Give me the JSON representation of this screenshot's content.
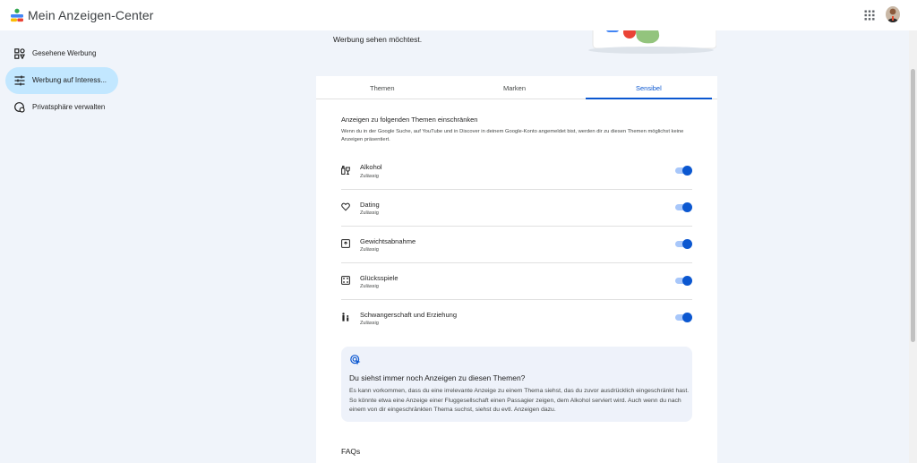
{
  "app": {
    "title": "Mein Anzeigen-Center"
  },
  "topbar": {
    "apps_icon": "apps-grid-icon",
    "avatar": "account-avatar"
  },
  "sidebar": {
    "items": [
      {
        "label": "Gesehene Werbung",
        "icon": "seen-ads-icon",
        "active": false
      },
      {
        "label": "Werbung auf Interess...",
        "icon": "tune-icon",
        "active": true
      },
      {
        "label": "Privatsphäre verwalten",
        "icon": "privacy-icon",
        "active": false
      }
    ]
  },
  "intro": {
    "text": "Werbung sehen möchtest."
  },
  "tabs": [
    {
      "label": "Themen",
      "active": false
    },
    {
      "label": "Marken",
      "active": false
    },
    {
      "label": "Sensibel",
      "active": true
    }
  ],
  "section": {
    "title": "Anzeigen zu folgenden Themen einschränken",
    "description": "Wenn du in der Google Suche, auf YouTube und in Discover in deinem Google-Konto angemeldet bist, werden dir zu diesen Themen möglichst keine Anzeigen präsentiert."
  },
  "topics": [
    {
      "title": "Alkohol",
      "status": "Zulässig",
      "icon": "alcohol-icon",
      "enabled": true
    },
    {
      "title": "Dating",
      "status": "Zulässig",
      "icon": "heart-icon",
      "enabled": true
    },
    {
      "title": "Gewichtsabnahme",
      "status": "Zulässig",
      "icon": "scale-icon",
      "enabled": true
    },
    {
      "title": "Glücksspiele",
      "status": "Zulässig",
      "icon": "dice-icon",
      "enabled": true
    },
    {
      "title": "Schwangerschaft und Erziehung",
      "status": "Zulässig",
      "icon": "family-icon",
      "enabled": true
    }
  ],
  "info": {
    "icon": "ads-click-icon",
    "title": "Du siehst immer noch Anzeigen zu diesen Themen?",
    "text": "Es kann vorkommen, dass du eine irrelevante Anzeige zu einem Thema siehst, das du zuvor ausdrücklich eingeschränkt hast. So könnte etwa eine Anzeige einer Fluggesellschaft einen Passagier zeigen, dem Alkohol serviert wird. Auch wenn du nach einem von dir eingeschränkten Thema suchst, siehst du evtl. Anzeigen dazu."
  },
  "faqs": {
    "title": "FAQs"
  },
  "colors": {
    "accent": "#0b57d0",
    "active_nav": "#c2e7ff",
    "page_bg": "#f0f4fa"
  }
}
